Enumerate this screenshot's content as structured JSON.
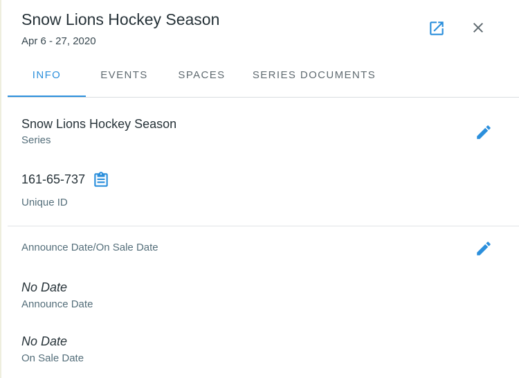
{
  "header": {
    "title": "Snow Lions Hockey Season",
    "date_range": "Apr 6 - 27, 2020"
  },
  "icons": {
    "open_external": "open-in-new-icon",
    "close": "close-icon",
    "edit": "pencil-icon",
    "copy": "clipboard-icon"
  },
  "colors": {
    "accent": "#2b8fdc",
    "text": "#263238",
    "muted": "#546e7a"
  },
  "tabs": [
    {
      "label": "INFO",
      "active": true
    },
    {
      "label": "EVENTS",
      "active": false
    },
    {
      "label": "SPACES",
      "active": false
    },
    {
      "label": "SERIES DOCUMENTS",
      "active": false
    }
  ],
  "info": {
    "series": {
      "value": "Snow Lions Hockey Season",
      "label": "Series"
    },
    "unique_id": {
      "value": "161-65-737",
      "label": "Unique ID"
    },
    "dates_section": {
      "title": "Announce Date/On Sale Date",
      "announce": {
        "value": "No Date",
        "label": "Announce Date"
      },
      "on_sale": {
        "value": "No Date",
        "label": "On Sale Date"
      }
    }
  }
}
